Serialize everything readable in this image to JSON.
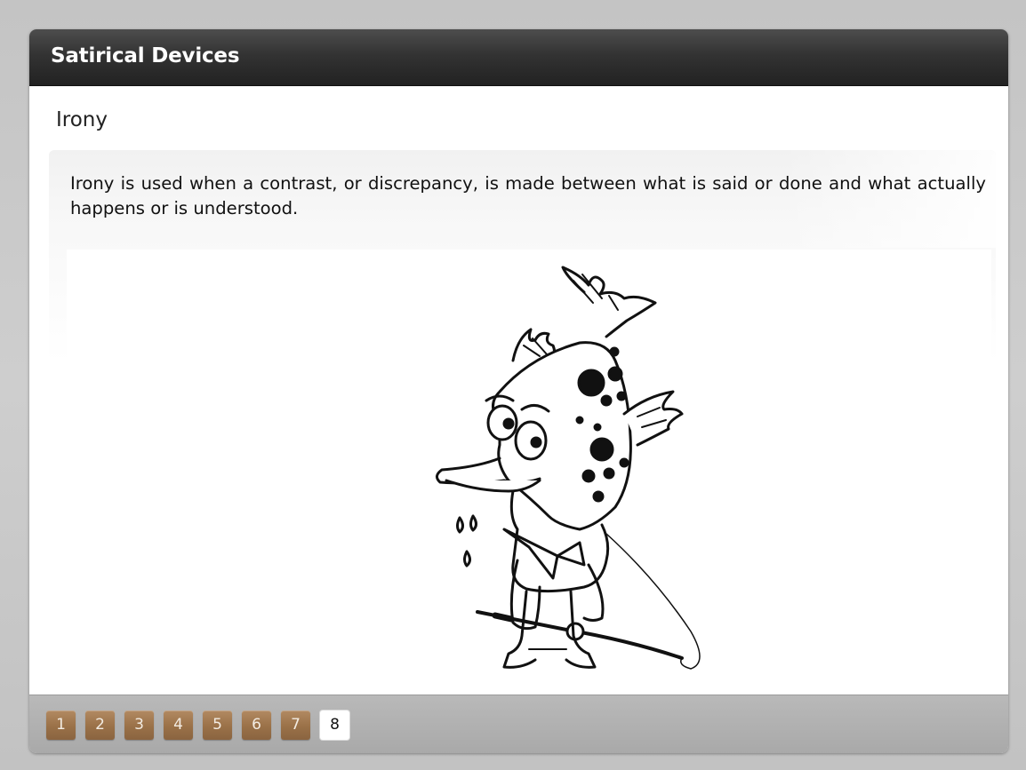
{
  "header": {
    "title": "Satirical Devices"
  },
  "content": {
    "heading": "Irony",
    "definition": "Irony is used when a contrast, or discrepancy, is made between what is said or done and what actually happens or is understood.",
    "image": {
      "icon": "fish-fisherman-cartoon-illustration"
    }
  },
  "pagination": {
    "pages": [
      "1",
      "2",
      "3",
      "4",
      "5",
      "6",
      "7",
      "8"
    ],
    "current": "8"
  },
  "colors": {
    "titlebar": "#333333",
    "page_button": "#9a7148",
    "page_button_current": "#ffffff",
    "footer": "#b0b0b0"
  }
}
